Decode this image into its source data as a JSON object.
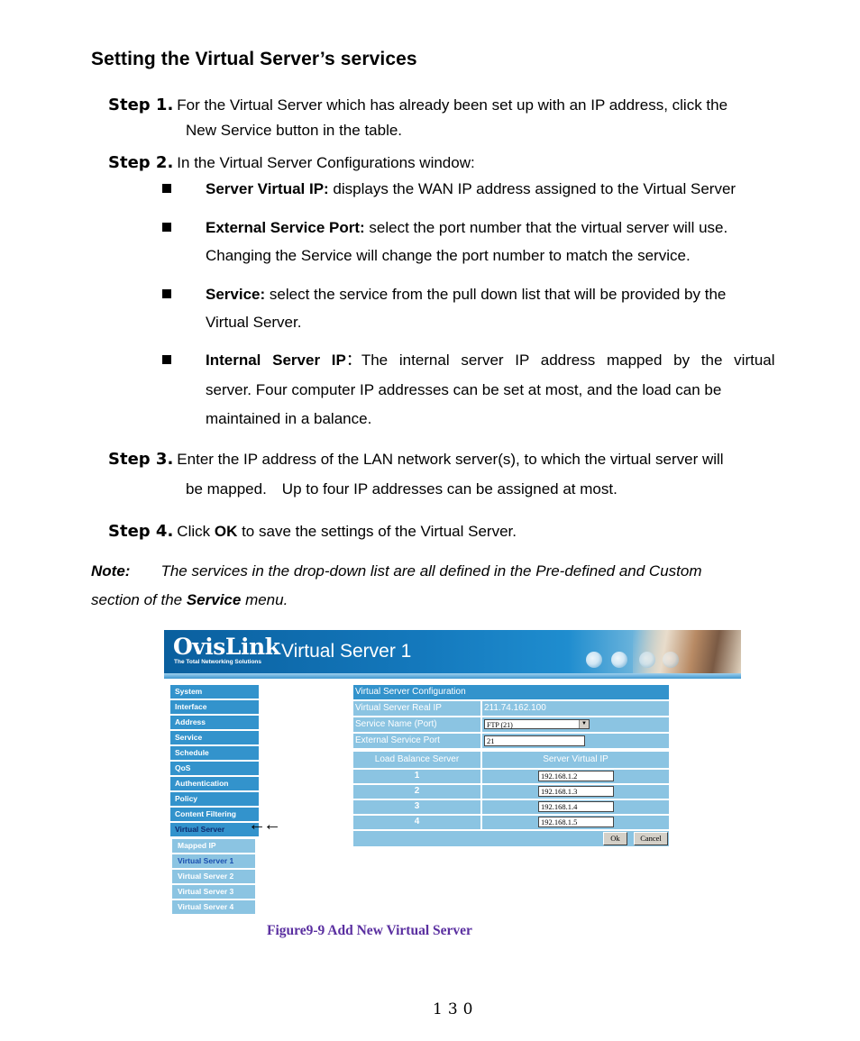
{
  "heading": "Setting the Virtual Server’s services",
  "steps": [
    {
      "label": "Step 1.",
      "text": "For the Virtual Server which has already been set up with an IP address, click the",
      "cont": "New Service button in the table."
    },
    {
      "label": "Step 2.",
      "text": "In the Virtual Server Configurations window:"
    },
    {
      "label": "Step 3.",
      "text": "Enter the IP address of the LAN network server(s), to which the virtual server will",
      "cont": "be mapped.　Up to four IP addresses can be assigned at most."
    },
    {
      "label": "Step 4.",
      "text_pre": "Click ",
      "text_bold": "OK",
      "text_post": " to save the settings of the Virtual Server."
    }
  ],
  "bullets": [
    {
      "term": "Server Virtual IP:",
      "text": " displays the WAN IP address assigned to the Virtual Server"
    },
    {
      "term": "External Service Port:",
      "text": " select the port number that the virtual server will use.",
      "cont": "Changing the Service will change the port number to match the service."
    },
    {
      "term": "Service:",
      "text": " select the service from the pull down list that will be provided by the",
      "cont": "Virtual Server."
    },
    {
      "term": "Internal Server IP",
      "text": "：The internal server IP address mapped by the virtual",
      "cont": "server. Four computer IP addresses can be set at most, and the load can be",
      "cont2": "maintained in a balance."
    }
  ],
  "note": {
    "label": "Note:",
    "text": "The services in the drop-down list are all defined in the Pre-defined and Custom",
    "cont_pre": "section of the ",
    "cont_bold": "Service",
    "cont_post": " menu."
  },
  "figure": {
    "logo": "OvisLink",
    "tagline": "The Total Networking Solutions",
    "page_title": "Virtual Server 1",
    "menu": [
      "System",
      "Interface",
      "Address",
      "Service",
      "Schedule",
      "QoS",
      "Authentication",
      "Policy",
      "Content Filtering",
      "Virtual Server"
    ],
    "submenu": [
      "Mapped IP",
      "Virtual Server 1",
      "Virtual Server 2",
      "Virtual Server 3",
      "Virtual Server 4"
    ],
    "arrows": "🡐🡐",
    "config": {
      "title": "Virtual Server Configuration",
      "real_ip_label": "Virtual Server Real IP",
      "real_ip_value": "211.74.162.100",
      "service_label": "Service Name (Port)",
      "service_value": "FTP (21)",
      "port_label": "External Service Port",
      "port_value": "21",
      "lb_header": "Load Balance Server",
      "ip_header": "Server Virtual IP",
      "servers": [
        {
          "n": "1",
          "ip": "192.168.1.2"
        },
        {
          "n": "2",
          "ip": "192.168.1.3"
        },
        {
          "n": "3",
          "ip": "192.168.1.4"
        },
        {
          "n": "4",
          "ip": "192.168.1.5"
        }
      ],
      "ok_label": "Ok",
      "cancel_label": "Cancel"
    }
  },
  "caption": "Figure9-9 Add New Virtual Server",
  "page_number": "130"
}
